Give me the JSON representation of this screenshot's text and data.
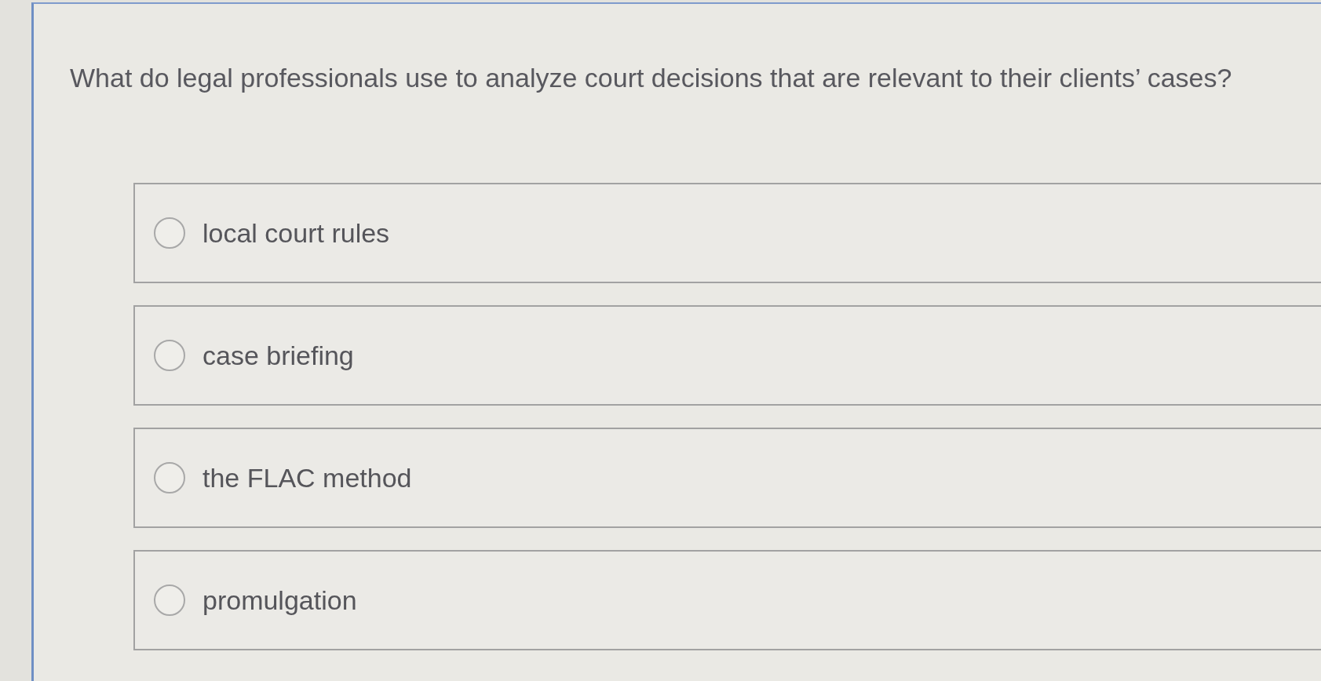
{
  "question": "What do legal professionals use to analyze court decisions that are relevant to their clients’ cases?",
  "options": [
    {
      "label": "local court rules",
      "selected": false
    },
    {
      "label": "case briefing",
      "selected": false
    },
    {
      "label": "the FLAC method",
      "selected": false
    },
    {
      "label": "promulgation",
      "selected": false
    }
  ]
}
